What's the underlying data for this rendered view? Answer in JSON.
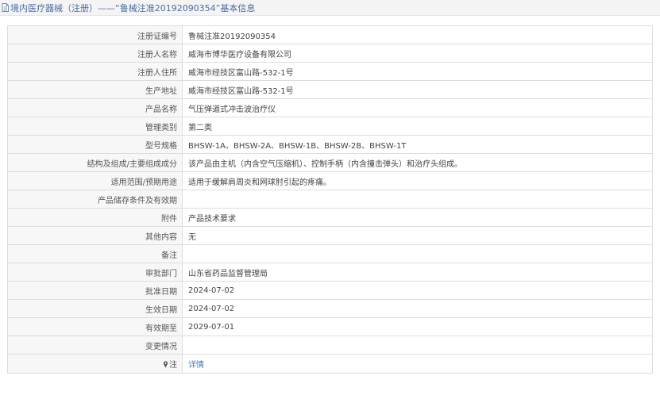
{
  "header": {
    "title": "境内医疗器械（注册）——“鲁械注准20192090354”基本信息",
    "icon": "document-icon"
  },
  "rows": [
    {
      "label": "注册证编号",
      "value": "鲁械注准20192090354"
    },
    {
      "label": "注册人名称",
      "value": "威海市博华医疗设备有限公司"
    },
    {
      "label": "注册人住所",
      "value": "威海市经技区富山路-532-1号"
    },
    {
      "label": "生产地址",
      "value": "威海市经技区富山路-532-1号"
    },
    {
      "label": "产品名称",
      "value": "气压弹道式冲击波治疗仪"
    },
    {
      "label": "管理类别",
      "value": "第二类"
    },
    {
      "label": "型号规格",
      "value": "BHSW-1A、BHSW-2A、BHSW-1B、BHSW-2B、BHSW-1T"
    },
    {
      "label": "结构及组成/主要组成成分",
      "value": "该产品由主机（内含空气压缩机）、控制手柄（内含撞击弹头）和治疗头组成。"
    },
    {
      "label": "适用范围/预期用途",
      "value": "适用于缓解肩周炎和网球肘引起的疼痛。"
    },
    {
      "label": "产品储存条件及有效期",
      "value": ""
    },
    {
      "label": "附件",
      "value": "产品技术要求"
    },
    {
      "label": "其他内容",
      "value": "无"
    },
    {
      "label": "备注",
      "value": ""
    },
    {
      "label": "审批部门",
      "value": "山东省药品监督管理局"
    },
    {
      "label": "批准日期",
      "value": "2024-07-02"
    },
    {
      "label": "生效日期",
      "value": "2024-07-02"
    },
    {
      "label": "有效期至",
      "value": "2029-07-01"
    },
    {
      "label": "变更情况",
      "value": ""
    }
  ],
  "note_row": {
    "label": "注",
    "icon": "pin-icon",
    "link_label": "详情"
  },
  "colors": {
    "title": "#4a6ea5",
    "link": "#3b79c5",
    "label_bg": "#f7f7f7",
    "border": "#dddddd"
  }
}
